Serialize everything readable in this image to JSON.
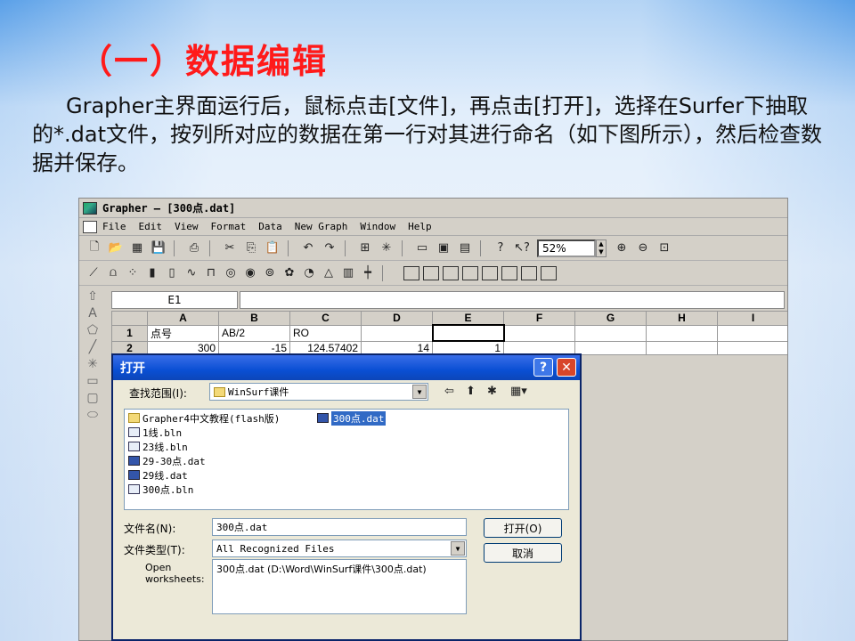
{
  "slide": {
    "title": "（一）数据编辑",
    "paragraph": "Grapher主界面运行后，鼠标点击[文件]，再点击[打开]，选择在Surfer下抽取的*.dat文件，按列所对应的数据在第一行对其进行命名（如下图所示），然后检查数据并保存。"
  },
  "app": {
    "window_title": "Grapher – [300点.dat]",
    "menu": [
      "File",
      "Edit",
      "View",
      "Format",
      "Data",
      "New Graph",
      "Window",
      "Help"
    ],
    "zoom": "52%",
    "cell_ref": "E1",
    "columns": [
      "A",
      "B",
      "C",
      "D",
      "E",
      "F",
      "G",
      "H",
      "I"
    ],
    "rows": [
      {
        "num": "1",
        "cells": [
          "点号",
          "AB/2",
          "RO",
          "",
          "",
          "",
          "",
          "",
          ""
        ]
      },
      {
        "num": "2",
        "cells": [
          "300",
          "-15",
          "124.57402",
          "14",
          "1",
          "",
          "",
          "",
          ""
        ]
      }
    ]
  },
  "dialog": {
    "title": "打开",
    "look_in_label": "查找范围(I):",
    "look_in_value": "WinSurf课件",
    "files": [
      {
        "name": "Grapher4中文教程(flash版)",
        "type": "folder"
      },
      {
        "name": "1线.bln",
        "type": "bln"
      },
      {
        "name": "23线.bln",
        "type": "bln"
      },
      {
        "name": "29-30点.dat",
        "type": "dat"
      },
      {
        "name": "29线.dat",
        "type": "dat"
      },
      {
        "name": "300点.bln",
        "type": "bln"
      },
      {
        "name": "300点.dat",
        "type": "dat",
        "selected": true
      }
    ],
    "filename_label": "文件名(N):",
    "filename_value": "300点.dat",
    "filetype_label": "文件类型(T):",
    "filetype_value": "All Recognized Files",
    "open_ws_label": "Open worksheets:",
    "open_ws_value": "300点.dat (D:\\Word\\WinSurf课件\\300点.dat)",
    "open_button": "打开(O)",
    "cancel_button": "取消"
  }
}
